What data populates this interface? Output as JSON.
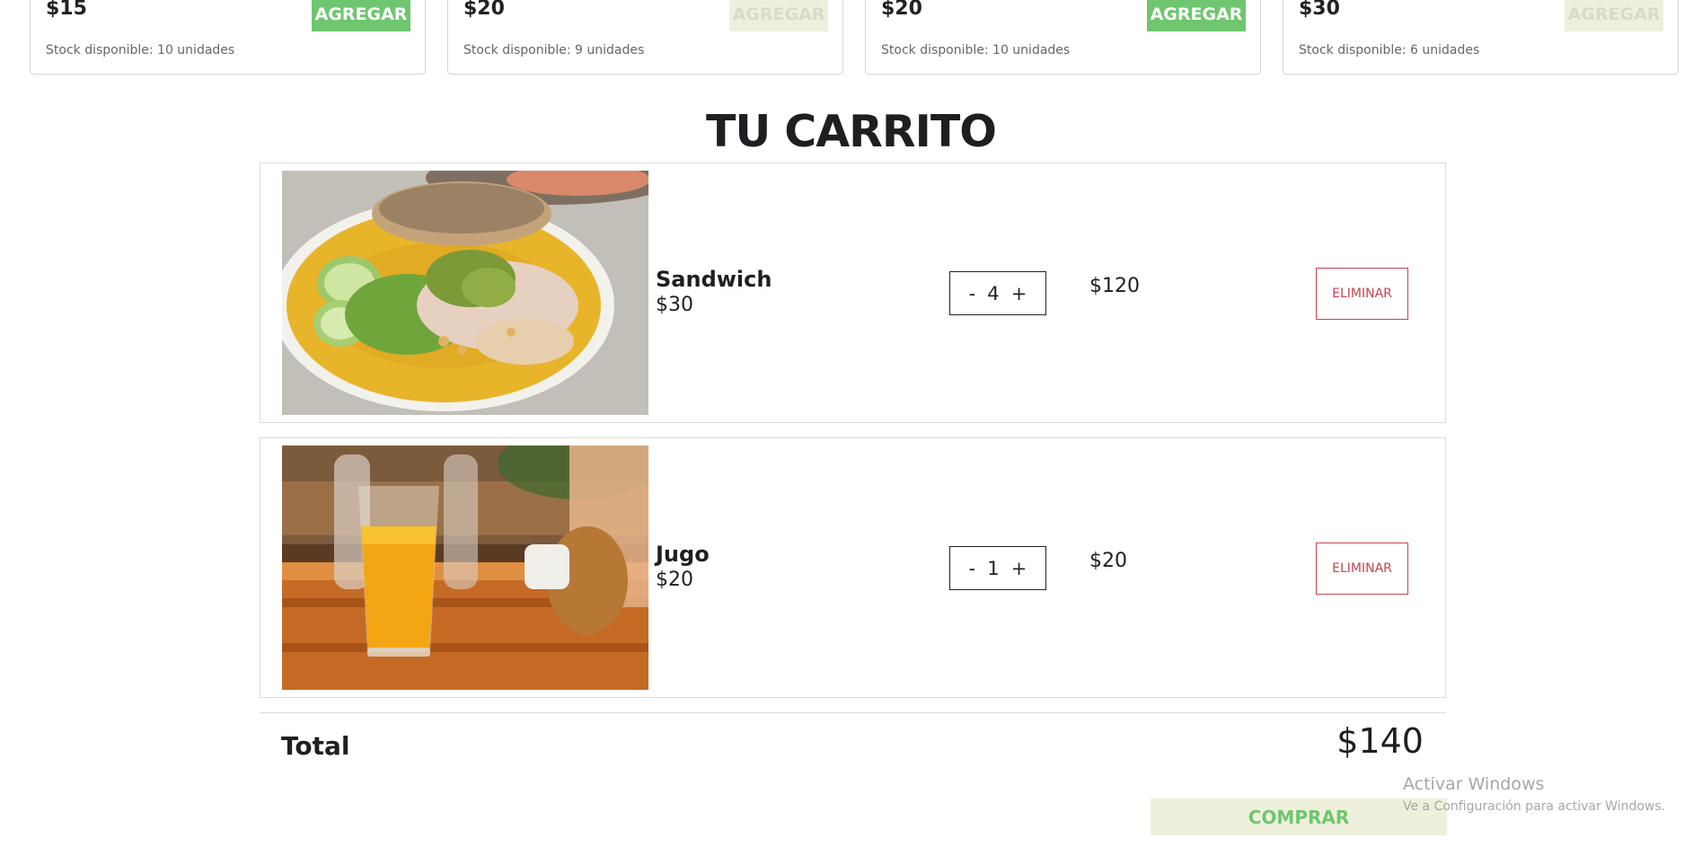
{
  "products": [
    {
      "price": "$15",
      "button_label": "AGREGAR",
      "button_enabled": true,
      "stock": "Stock disponible: 10 unidades"
    },
    {
      "price": "$20",
      "button_label": "AGREGAR",
      "button_enabled": false,
      "stock": "Stock disponible: 9 unidades"
    },
    {
      "price": "$20",
      "button_label": "AGREGAR",
      "button_enabled": true,
      "stock": "Stock disponible: 10 unidades"
    },
    {
      "price": "$30",
      "button_label": "AGREGAR",
      "button_enabled": false,
      "stock": "Stock disponible: 6 unidades"
    }
  ],
  "cart": {
    "title": "TU CARRITO",
    "items": [
      {
        "image_icon": "sandwich-photo",
        "name": "Sandwich",
        "unit_price": "$30",
        "decrement": "-",
        "quantity": "4",
        "increment": "+",
        "subtotal": "$120",
        "remove_label": "ELIMINAR"
      },
      {
        "image_icon": "orange-juice-photo",
        "name": "Jugo",
        "unit_price": "$20",
        "decrement": "-",
        "quantity": "1",
        "increment": "+",
        "subtotal": "$20",
        "remove_label": "ELIMINAR"
      }
    ],
    "total_label": "Total",
    "total_value": "$140",
    "buy_label": "COMPRAR"
  },
  "watermark": {
    "title": "Activar Windows",
    "subtitle": "Ve a Configuración para activar Windows."
  },
  "colors": {
    "accent_green": "#6fc66f",
    "disabled_bg": "#eef0dc",
    "remove_red": "#c44553",
    "text_dark": "#1d1f22"
  }
}
